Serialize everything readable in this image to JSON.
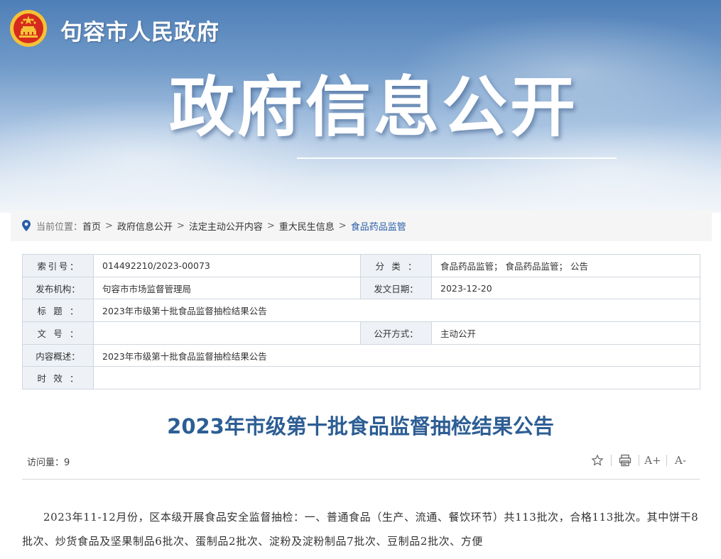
{
  "header": {
    "site_name": "句容市人民政府",
    "section_title": "政府信息公开",
    "emblem_icon": "national-emblem-icon"
  },
  "breadcrumb": {
    "label": "当前位置：",
    "items": [
      "首页",
      "政府信息公开",
      "法定主动公开内容",
      "重大民生信息",
      "食品药品监管"
    ],
    "separator": ">"
  },
  "meta": {
    "index_label": "索引号：",
    "index_value": "014492210/2023-00073",
    "category_label": "分类：",
    "category_value": "食品药品监管； 食品药品监管； 公告",
    "publisher_label": "发布机构：",
    "publisher_value": "句容市市场监督管理局",
    "date_label": "发文日期：",
    "date_value": "2023-12-20",
    "title_label": "标题：",
    "title_value": "2023年市级第十批食品监督抽检结果公告",
    "docno_label": "文号：",
    "docno_value": "",
    "disclosure_label": "公开方式：",
    "disclosure_value": "主动公开",
    "summary_label": "内容概述：",
    "summary_value": "2023年市级第十批食品监督抽检结果公告",
    "validity_label": "时效：",
    "validity_value": ""
  },
  "article": {
    "title": "2023年市级第十批食品监督抽检结果公告",
    "visits_label": "访问量：",
    "visits": "9",
    "body": "2023年11-12月份，区本级开展食品安全监督抽检：一、普通食品（生产、流通、餐饮环节）共113批次，合格113批次。其中饼干8批次、炒货食品及坚果制品6批次、蛋制品2批次、淀粉及淀粉制品7批次、豆制品2批次、方便"
  },
  "tools": {
    "favorite_icon": "star-icon",
    "print_icon": "printer-icon",
    "font_increase": "A+",
    "font_decrease": "A-"
  },
  "colors": {
    "accent": "#2d5e94",
    "breadcrumb_current": "#2a5ea8",
    "table_key_bg": "#eef2f7",
    "table_border": "#cfd6de"
  }
}
